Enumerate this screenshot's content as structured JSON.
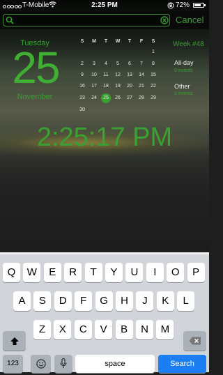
{
  "status_bar": {
    "carrier": "T-Mobile",
    "time": "2:25 PM",
    "battery": "72%",
    "battery_level": 0.72,
    "signal_dots": 5,
    "icons": [
      "signal-dots-icon",
      "wifi-icon",
      "orientation-lock-icon",
      "battery-icon"
    ]
  },
  "search": {
    "value": "",
    "placeholder": "",
    "cancel_label": "Cancel"
  },
  "date": {
    "weekday": "Tuesday",
    "day": "25",
    "month": "November"
  },
  "calendar": {
    "weekday_headers": [
      "S",
      "M",
      "T",
      "W",
      "T",
      "F",
      "S"
    ],
    "rows": [
      [
        "",
        "",
        "",
        "",
        "",
        "",
        "1"
      ],
      [
        "2",
        "3",
        "4",
        "5",
        "6",
        "7",
        "8"
      ],
      [
        "9",
        "10",
        "11",
        "12",
        "13",
        "14",
        "15"
      ],
      [
        "16",
        "17",
        "18",
        "19",
        "20",
        "21",
        "22"
      ],
      [
        "23",
        "24",
        "25",
        "26",
        "27",
        "28",
        "29"
      ],
      [
        "30",
        "",
        "",
        "",
        "",
        "",
        ""
      ]
    ],
    "selected": "25"
  },
  "sidebar": {
    "week": "Week #48",
    "groups": [
      {
        "title": "All-day",
        "count": "0 events"
      },
      {
        "title": "Other",
        "count": "3 events"
      }
    ]
  },
  "clock": "2:25:17 PM",
  "keyboard": {
    "row1": [
      "Q",
      "W",
      "E",
      "R",
      "T",
      "Y",
      "U",
      "I",
      "O",
      "P"
    ],
    "row2": [
      "A",
      "S",
      "D",
      "F",
      "G",
      "H",
      "J",
      "K",
      "L"
    ],
    "row3": [
      "Z",
      "X",
      "C",
      "V",
      "B",
      "N",
      "M"
    ],
    "numbers_label": "123",
    "space_label": "space",
    "search_label": "Search",
    "icons": {
      "shift": "shift-icon",
      "delete": "delete-icon",
      "emoji": "emoji-icon",
      "mic": "microphone-icon"
    }
  },
  "colors": {
    "accent": "#3aa032",
    "keyboard_bg": "#d1d4d8",
    "search_key": "#1b7ef2"
  }
}
